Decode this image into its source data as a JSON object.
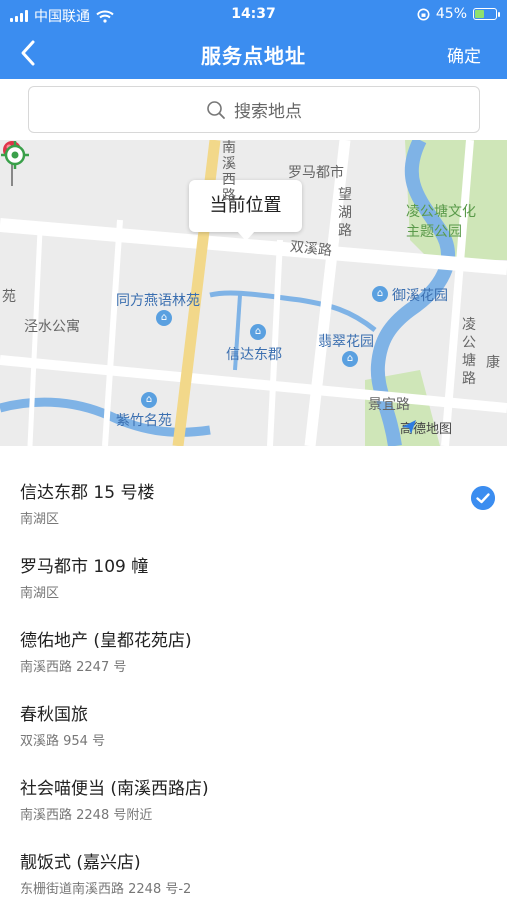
{
  "status": {
    "carrier": "中国联通",
    "time": "14:37",
    "battery": "45%",
    "battery_level": 0.45
  },
  "nav": {
    "title": "服务点地址",
    "confirm": "确定"
  },
  "search": {
    "placeholder": "搜索地点"
  },
  "map": {
    "callout": "当前位置",
    "labels": {
      "luoma": "罗马都市",
      "linggong_park": "凌公塘文化\n主题公园",
      "shuangxi": "双溪路",
      "wanghu": "望湖路",
      "tongfang": "同方燕语林苑",
      "yuxi": "御溪花园",
      "jingshui": "泾水公寓",
      "xinda": "信达东郡",
      "feicui": "翡翠花园",
      "lingong_road": "凌公塘路",
      "kang": "康",
      "zizhu": "紫竹名苑",
      "jingyi": "景宜路",
      "nanxi": "南溪西路",
      "yuan": "苑"
    },
    "brand": "高德地图"
  },
  "list": [
    {
      "name": "信达东郡 15 号楼",
      "addr": "南湖区",
      "selected": true
    },
    {
      "name": "罗马都市 109 幢",
      "addr": "南湖区",
      "selected": false
    },
    {
      "name": "德佑地产 (皇都花苑店)",
      "addr": "南溪西路 2247 号",
      "selected": false
    },
    {
      "name": "春秋国旅",
      "addr": "双溪路 954 号",
      "selected": false
    },
    {
      "name": "社会喵便当 (南溪西路店)",
      "addr": "南溪西路 2248 号附近",
      "selected": false
    },
    {
      "name": "靓饭式 (嘉兴店)",
      "addr": "东栅街道南溪西路 2248 号-2",
      "selected": false
    }
  ],
  "colors": {
    "accent": "#3b8df0",
    "water": "#7fb3e6",
    "park": "#cfe6b8"
  }
}
